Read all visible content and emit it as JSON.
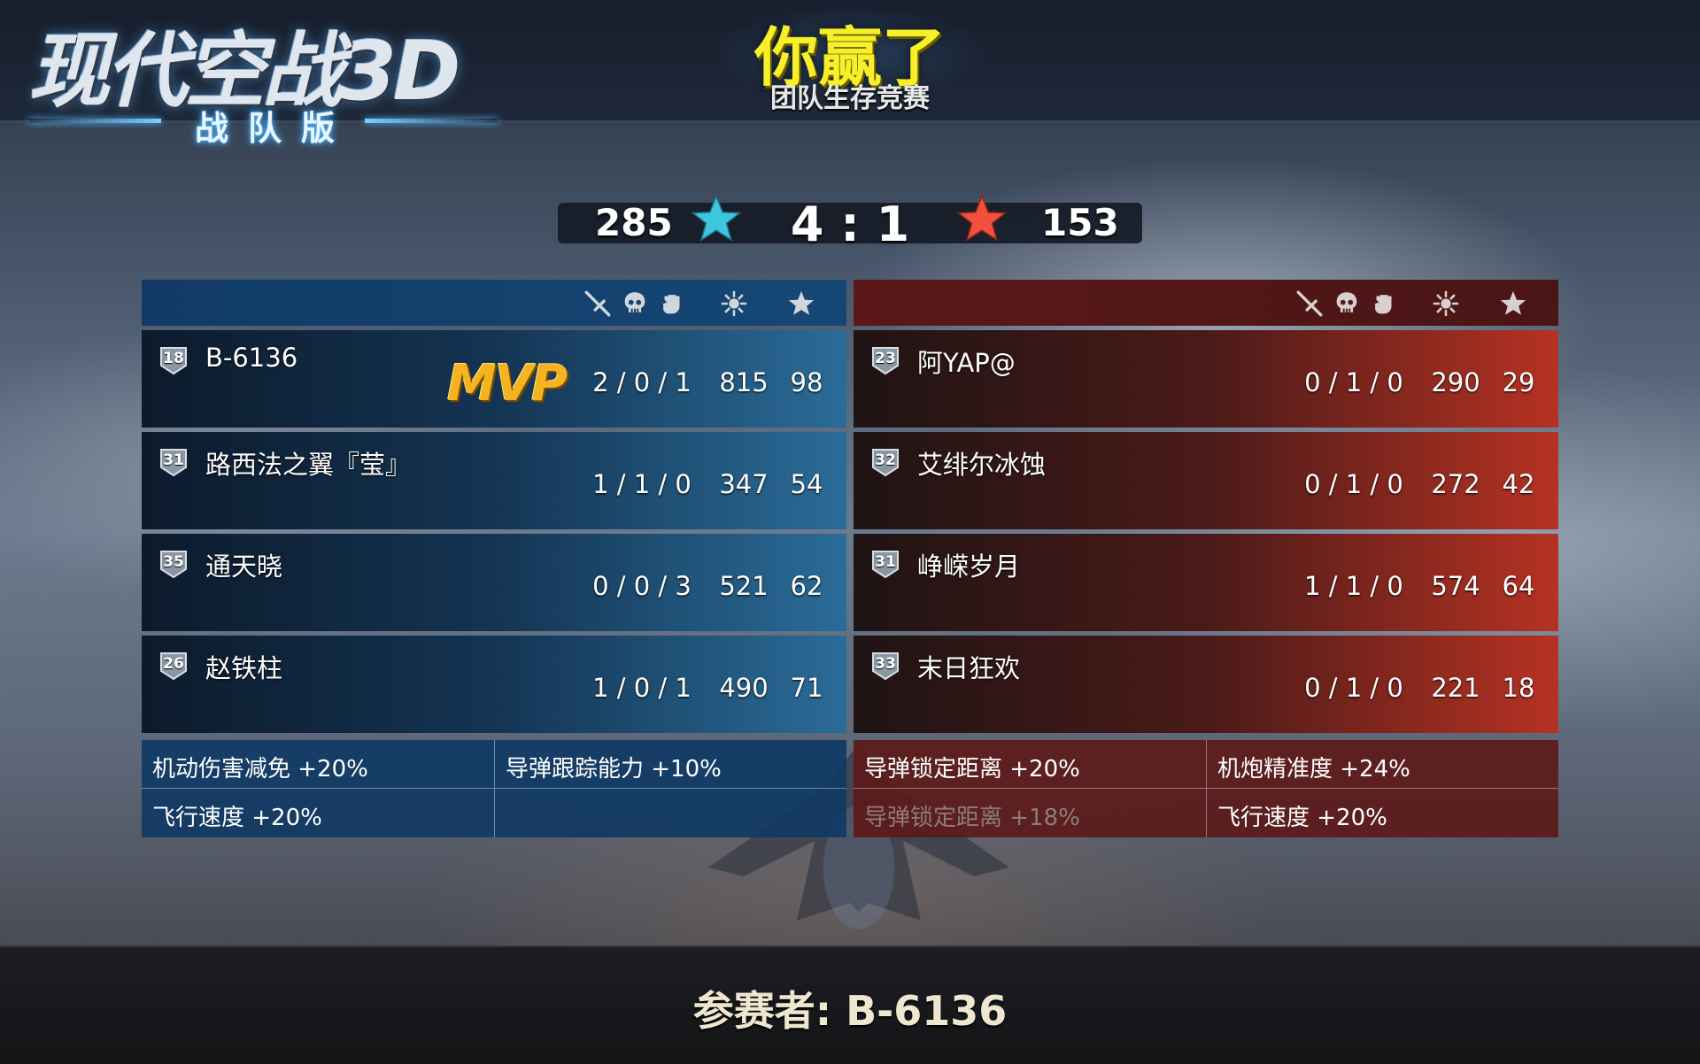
{
  "game": {
    "logo_title": "现代空战3D",
    "logo_subtitle": "战队版"
  },
  "result": {
    "title": "你赢了",
    "mode": "团队生存竞赛"
  },
  "scoreboard": {
    "blue_total": "285",
    "red_total": "153",
    "ratio": "4 : 1",
    "blue_star_color": "#3ec6e0",
    "red_star_color": "#f0503c"
  },
  "columns": {
    "icons": [
      "sword-icon",
      "skull-icon",
      "fist-icon",
      "burst-icon",
      "star-icon"
    ]
  },
  "blue_team": {
    "accent": "#1a5a94",
    "players": [
      {
        "level": "18",
        "name": "B-6136",
        "mvp": "MVP",
        "kda": "2 / 0 / 1",
        "score": "815",
        "stars": "98"
      },
      {
        "level": "31",
        "name": "路西法之翼『莹』",
        "kda": "1 / 1 / 0",
        "score": "347",
        "stars": "54"
      },
      {
        "level": "35",
        "name": "通天晓",
        "kda": "0 / 0 / 3",
        "score": "521",
        "stars": "62"
      },
      {
        "level": "26",
        "name": "赵铁柱",
        "kda": "1 / 0 / 1",
        "score": "490",
        "stars": "71"
      }
    ],
    "bonuses": [
      "机动伤害减免 +20%",
      "导弹跟踪能力 +10%",
      "飞行速度 +20%",
      ""
    ]
  },
  "red_team": {
    "accent": "#b63223",
    "players": [
      {
        "level": "23",
        "name": "阿YAP@",
        "kda": "0 / 1 / 0",
        "score": "290",
        "stars": "29"
      },
      {
        "level": "32",
        "name": "艾绯尔冰蚀",
        "kda": "0 / 1 / 0",
        "score": "272",
        "stars": "42"
      },
      {
        "level": "31",
        "name": "峥嵘岁月",
        "kda": "1 / 1 / 0",
        "score": "574",
        "stars": "64"
      },
      {
        "level": "33",
        "name": "末日狂欢",
        "kda": "0 / 1 / 0",
        "score": "221",
        "stars": "18"
      }
    ],
    "bonuses": [
      "导弹锁定距离 +20%",
      "机炮精准度 +24%",
      "导弹锁定距离 +18%",
      "飞行速度 +20%"
    ]
  },
  "footer": {
    "participant": "参赛者: B-6136"
  }
}
